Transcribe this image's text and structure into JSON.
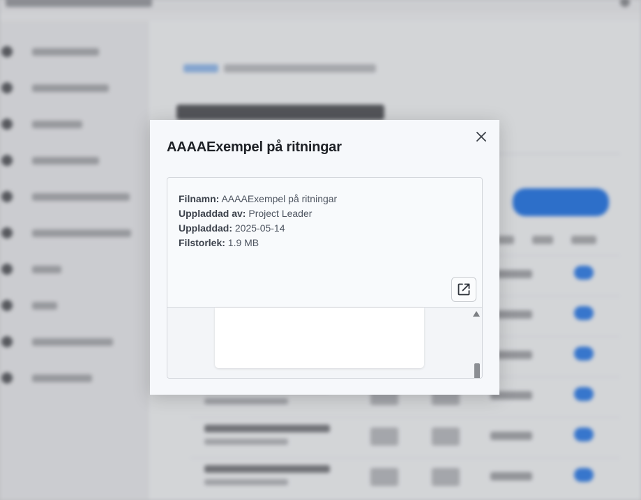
{
  "modal": {
    "title": "AAAAExempel på ritningar",
    "details": [
      {
        "label": "Filnamn:",
        "value": "AAAAExempel på ritningar"
      },
      {
        "label": "Uppladdad av:",
        "value": "Project Leader"
      },
      {
        "label": "Uppladdad:",
        "value": "2025-05-14"
      },
      {
        "label": "Filstorlek:",
        "value": "1.9 MB"
      }
    ],
    "close_icon": "close-icon",
    "open_icon": "open-external-icon"
  },
  "colors": {
    "accent": "#2f7ae0",
    "modal_bg": "#f6f8fb",
    "title_text": "#1e2126"
  }
}
